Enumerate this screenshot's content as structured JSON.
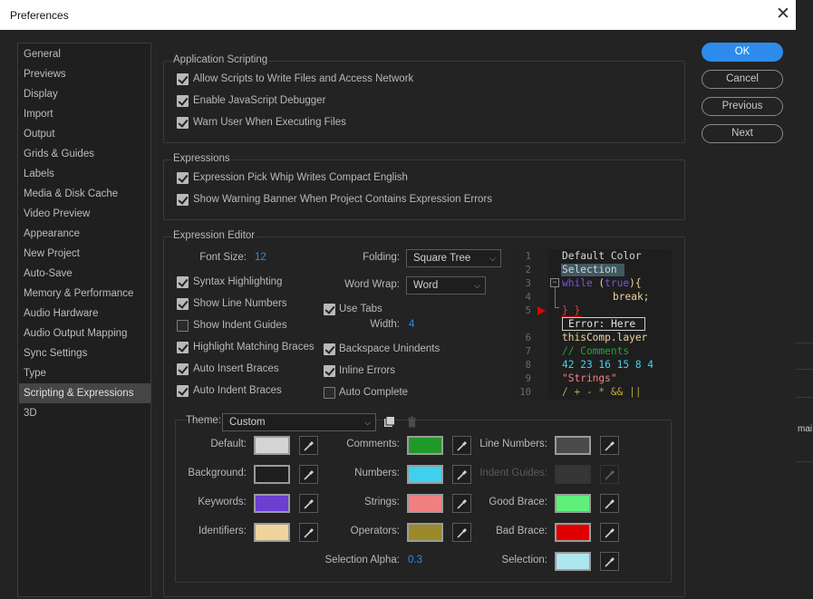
{
  "window": {
    "title": "Preferences"
  },
  "sidebar": {
    "items": [
      {
        "label": "General"
      },
      {
        "label": "Previews"
      },
      {
        "label": "Display"
      },
      {
        "label": "Import"
      },
      {
        "label": "Output"
      },
      {
        "label": "Grids & Guides"
      },
      {
        "label": "Labels"
      },
      {
        "label": "Media & Disk Cache"
      },
      {
        "label": "Video Preview"
      },
      {
        "label": "Appearance"
      },
      {
        "label": "New Project"
      },
      {
        "label": "Auto-Save"
      },
      {
        "label": "Memory & Performance"
      },
      {
        "label": "Audio Hardware"
      },
      {
        "label": "Audio Output Mapping"
      },
      {
        "label": "Sync Settings"
      },
      {
        "label": "Type"
      },
      {
        "label": "Scripting & Expressions"
      },
      {
        "label": "3D"
      }
    ],
    "selected": "Scripting & Expressions"
  },
  "buttons": {
    "ok": "OK",
    "cancel": "Cancel",
    "previous": "Previous",
    "next": "Next"
  },
  "app_scripting": {
    "title": "Application Scripting",
    "allow_scripts": "Allow Scripts to Write Files and Access Network",
    "enable_debugger": "Enable JavaScript Debugger",
    "warn_user": "Warn User When Executing Files"
  },
  "expressions": {
    "title": "Expressions",
    "pick_whip": "Expression Pick Whip Writes Compact English",
    "warning_banner": "Show Warning Banner When Project Contains Expression Errors"
  },
  "editor": {
    "title": "Expression Editor",
    "font_size_label": "Font Size:",
    "font_size_value": "12",
    "syntax_highlighting": "Syntax Highlighting",
    "show_line_numbers": "Show Line Numbers",
    "show_indent_guides": "Show Indent Guides",
    "highlight_braces": "Highlight Matching Braces",
    "auto_insert_braces": "Auto Insert Braces",
    "auto_indent_braces": "Auto Indent Braces",
    "folding_label": "Folding:",
    "folding_value": "Square Tree",
    "word_wrap_label": "Word Wrap:",
    "word_wrap_value": "Word",
    "use_tabs": "Use Tabs",
    "width_label": "Width:",
    "width_value": "4",
    "backspace_unindents": "Backspace Unindents",
    "inline_errors": "Inline Errors",
    "auto_complete": "Auto Complete"
  },
  "preview": {
    "line_numbers": [
      "1",
      "2",
      "3",
      "4",
      "5",
      "",
      "6",
      "7",
      "8",
      "9",
      "10"
    ],
    "line1": "Default Color",
    "line2": "Selection",
    "line3a": "while",
    "line3b": " (",
    "line3c": "true",
    "line3d": "){",
    "line4": "break;",
    "line5": "} }",
    "error_text": "Error: Here",
    "line6": "thisComp.layer",
    "line7": "// Comments",
    "line8": "42 23 16 15 8 4",
    "line9": "\"Strings\"",
    "line10": "/ + - * && ||"
  },
  "theme": {
    "label": "Theme:",
    "value": "Custom",
    "colors": {
      "default": {
        "label": "Default:",
        "hex": "#d4d4d4"
      },
      "background": {
        "label": "Background:",
        "hex": "#1e1e1e"
      },
      "keywords": {
        "label": "Keywords:",
        "hex": "#6b3fd0"
      },
      "identifiers": {
        "label": "Identifiers:",
        "hex": "#f0d39a"
      },
      "comments": {
        "label": "Comments:",
        "hex": "#1f9a2a"
      },
      "numbers": {
        "label": "Numbers:",
        "hex": "#3fd0f0"
      },
      "strings": {
        "label": "Strings:",
        "hex": "#f08080"
      },
      "operators": {
        "label": "Operators:",
        "hex": "#9a8a2a"
      },
      "line_numbers": {
        "label": "Line Numbers:",
        "hex": "#4a4a4a"
      },
      "indent_guides": {
        "label": "Indent Guides:",
        "hex": "#4a4a4a"
      },
      "good_brace": {
        "label": "Good Brace:",
        "hex": "#5ef07a"
      },
      "bad_brace": {
        "label": "Bad Brace:",
        "hex": "#e00000"
      },
      "selection": {
        "label": "Selection:",
        "hex": "#aee6f0"
      }
    },
    "selection_alpha_label": "Selection Alpha:",
    "selection_alpha_value": "0.3"
  },
  "host_app": {
    "partial_text": "mai"
  }
}
